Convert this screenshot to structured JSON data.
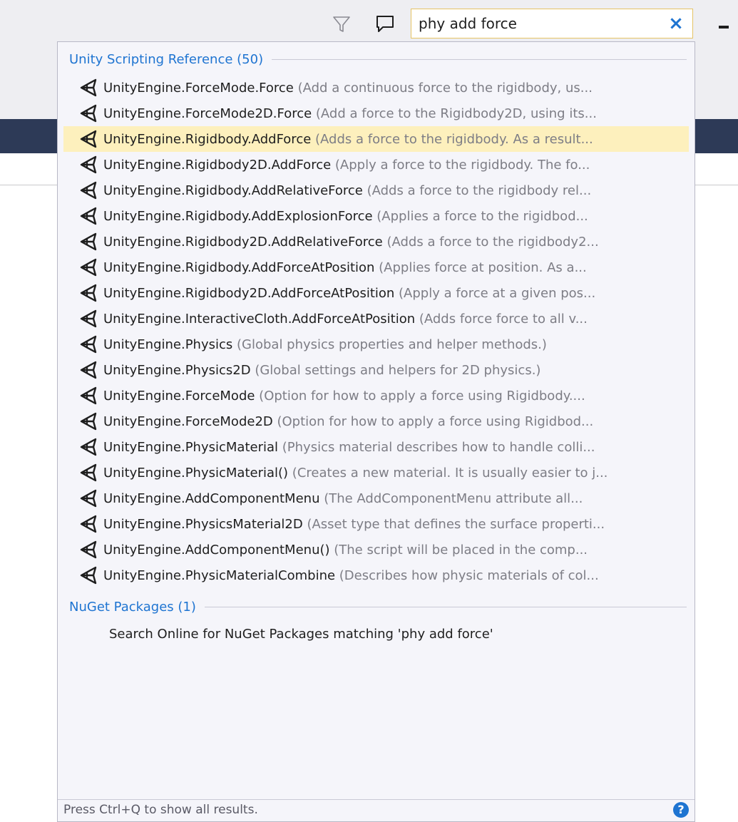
{
  "search": {
    "value": "phy add force",
    "clear_glyph": "×"
  },
  "groups": [
    {
      "label": "Unity Scripting Reference (50)"
    },
    {
      "label": "NuGet Packages (1)"
    }
  ],
  "results": [
    {
      "name": "UnityEngine.ForceMode.Force",
      "desc": " (Add a continuous force to the rigidbody, us..."
    },
    {
      "name": "UnityEngine.ForceMode2D.Force",
      "desc": " (Add a force to the Rigidbody2D, using its..."
    },
    {
      "name": "UnityEngine.Rigidbody.AddForce",
      "desc": " (Adds a force to the rigidbody. As a result...",
      "selected": true
    },
    {
      "name": "UnityEngine.Rigidbody2D.AddForce",
      "desc": " (Apply a force to the rigidbody. The fo..."
    },
    {
      "name": "UnityEngine.Rigidbody.AddRelativeForce",
      "desc": " (Adds a force to the rigidbody rel..."
    },
    {
      "name": "UnityEngine.Rigidbody.AddExplosionForce",
      "desc": " (Applies a force to the rigidbod..."
    },
    {
      "name": "UnityEngine.Rigidbody2D.AddRelativeForce",
      "desc": " (Adds a force to the rigidbody2..."
    },
    {
      "name": "UnityEngine.Rigidbody.AddForceAtPosition",
      "desc": " (Applies force at position. As a..."
    },
    {
      "name": "UnityEngine.Rigidbody2D.AddForceAtPosition",
      "desc": " (Apply a force at a given pos..."
    },
    {
      "name": "UnityEngine.InteractiveCloth.AddForceAtPosition",
      "desc": " (Adds force force to all v..."
    },
    {
      "name": "UnityEngine.Physics",
      "desc": " (Global physics properties and helper methods.)"
    },
    {
      "name": "UnityEngine.Physics2D",
      "desc": " (Global settings and helpers for 2D physics.)"
    },
    {
      "name": "UnityEngine.ForceMode",
      "desc": " (Option for how to apply a force using Rigidbody...."
    },
    {
      "name": "UnityEngine.ForceMode2D",
      "desc": " (Option for how to apply a force using Rigidbod..."
    },
    {
      "name": "UnityEngine.PhysicMaterial",
      "desc": " (Physics material describes how to handle colli..."
    },
    {
      "name": "UnityEngine.PhysicMaterial()",
      "desc": " (Creates a new material. It is usually easier to j..."
    },
    {
      "name": "UnityEngine.AddComponentMenu",
      "desc": " (The AddComponentMenu attribute all..."
    },
    {
      "name": "UnityEngine.PhysicsMaterial2D",
      "desc": " (Asset type that defines the surface properti..."
    },
    {
      "name": "UnityEngine.AddComponentMenu()",
      "desc": " (The script will be placed in the comp..."
    },
    {
      "name": "UnityEngine.PhysicMaterialCombine",
      "desc": " (Describes how physic materials of col..."
    }
  ],
  "nuget": {
    "label": "Search Online for NuGet Packages matching 'phy add force'"
  },
  "footer": {
    "text": "Press Ctrl+Q to show all results.",
    "help_glyph": "?"
  },
  "icons": {
    "filter": "filter-icon",
    "feedback": "feedback-icon",
    "result": "unity-icon",
    "help": "help-icon"
  },
  "colors": {
    "accent": "#1e74d1",
    "selected_bg": "#fdf0bd",
    "search_border": "#e5c365",
    "title_bar": "#2d3a57"
  }
}
